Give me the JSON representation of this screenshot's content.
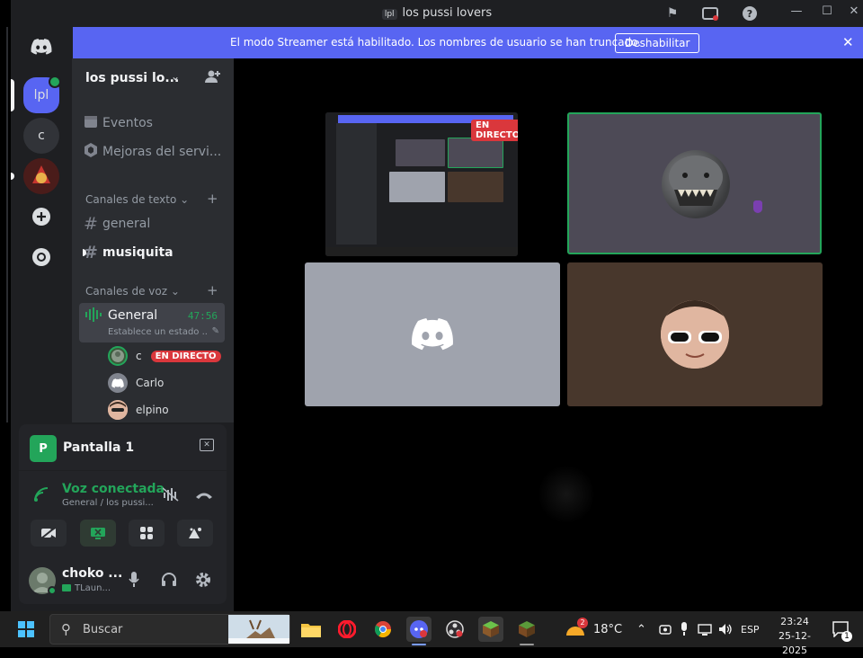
{
  "window": {
    "title": "los pussi lovers",
    "server_abbrev": "lpl"
  },
  "banner": {
    "message": "El modo Streamer está habilitado. Los nombres de usuario se han truncado.",
    "button": "Deshabilitar"
  },
  "rail": {
    "servers": [
      {
        "label": "lpl",
        "selected": true
      },
      {
        "label": "c"
      }
    ]
  },
  "sidebar": {
    "server_name": "los pussi lo...",
    "items": [
      {
        "label": "Eventos",
        "icon": "calendar-icon"
      },
      {
        "label": "Mejoras del servi...",
        "icon": "boost-icon"
      }
    ],
    "text_category": "Canales de texto",
    "text_channels": [
      {
        "name": "general",
        "unread": false
      },
      {
        "name": "musiquita",
        "unread": true
      }
    ],
    "voice_category": "Canales de voz",
    "voice_channel": {
      "name": "General",
      "timer": "47:56",
      "status": "Establece un estado ..."
    },
    "voice_users": [
      {
        "name": "c",
        "live": "EN DIRECTO"
      },
      {
        "name": "Carlo"
      },
      {
        "name": "elpino"
      }
    ]
  },
  "panel": {
    "stream_label": "Pantalla 1",
    "stream_icon_letter": "P",
    "voice_status": "Voz conectada",
    "voice_location": "General / los pussi...",
    "user_name": "choko ...",
    "user_activity": "TLaun..."
  },
  "stage": {
    "live_tag": "EN DIRECTO"
  },
  "taskbar": {
    "search_placeholder": "Buscar",
    "weather": "18°C",
    "weather_badge": "2",
    "language": "ESP",
    "time": "23:24",
    "date": "25-12-2025",
    "notification_count": "1"
  },
  "colors": {
    "accent": "#5865f2",
    "online": "#23a55a",
    "live": "#da373c"
  }
}
